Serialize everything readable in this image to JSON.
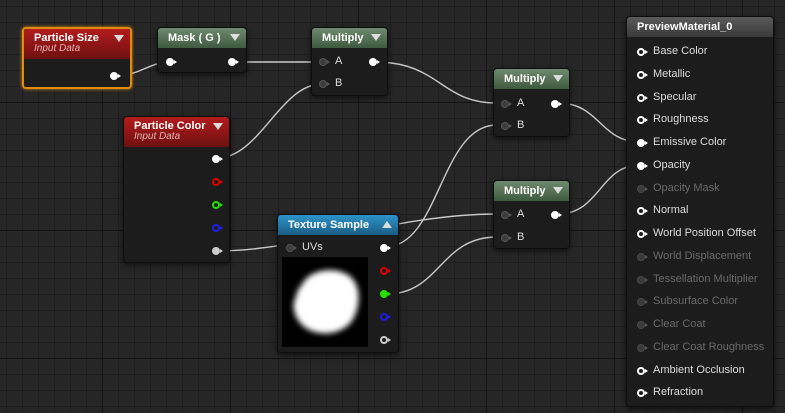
{
  "nodes": {
    "particle_size": {
      "title": "Particle Size",
      "subtitle": "Input Data"
    },
    "mask": {
      "title": "Mask ( G )"
    },
    "multiply_1": {
      "title": "Multiply",
      "pin_a": "A",
      "pin_b": "B"
    },
    "particle_color": {
      "title": "Particle Color",
      "subtitle": "Input Data"
    },
    "texture_sample": {
      "title": "Texture Sample",
      "pin_uvs": "UVs"
    },
    "multiply_2": {
      "title": "Multiply",
      "pin_a": "A",
      "pin_b": "B"
    },
    "multiply_3": {
      "title": "Multiply",
      "pin_a": "A",
      "pin_b": "B"
    },
    "material": {
      "title": "PreviewMaterial_0",
      "inputs": [
        {
          "label": "Base Color",
          "enabled": true
        },
        {
          "label": "Metallic",
          "enabled": true
        },
        {
          "label": "Specular",
          "enabled": true
        },
        {
          "label": "Roughness",
          "enabled": true
        },
        {
          "label": "Emissive Color",
          "enabled": true,
          "connected": true
        },
        {
          "label": "Opacity",
          "enabled": true,
          "connected": true
        },
        {
          "label": "Opacity Mask",
          "enabled": false
        },
        {
          "label": "Normal",
          "enabled": true
        },
        {
          "label": "World Position Offset",
          "enabled": true
        },
        {
          "label": "World Displacement",
          "enabled": false
        },
        {
          "label": "Tessellation Multiplier",
          "enabled": false
        },
        {
          "label": "Subsurface Color",
          "enabled": false
        },
        {
          "label": "Clear Coat",
          "enabled": false
        },
        {
          "label": "Clear Coat Roughness",
          "enabled": false
        },
        {
          "label": "Ambient Occlusion",
          "enabled": true
        },
        {
          "label": "Refraction",
          "enabled": true
        }
      ]
    }
  },
  "colors": {
    "wire": "#c8c8c8",
    "selection": "#e08a12",
    "pin_red": "#e00000",
    "pin_green": "#26e000",
    "pin_blue": "#1e1ee6",
    "pin_alpha": "#cccccc"
  }
}
